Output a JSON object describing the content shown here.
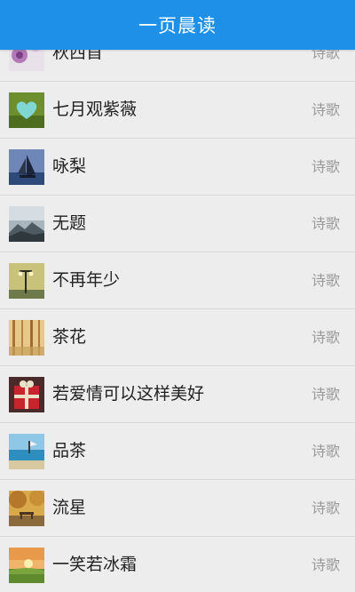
{
  "header": {
    "title": "一页晨读",
    "color": "#1e90e8"
  },
  "list": {
    "items": [
      {
        "title": "秋西首",
        "category": "诗歌",
        "thumb": "purple-flower-icon"
      },
      {
        "title": "七月观紫薇",
        "category": "诗歌",
        "thumb": "heart-lake-icon"
      },
      {
        "title": "咏梨",
        "category": "诗歌",
        "thumb": "sailboat-icon"
      },
      {
        "title": "无题",
        "category": "诗歌",
        "thumb": "misty-mountain-icon"
      },
      {
        "title": "不再年少",
        "category": "诗歌",
        "thumb": "street-lamp-icon"
      },
      {
        "title": "茶花",
        "category": "诗歌",
        "thumb": "sunlit-trees-icon"
      },
      {
        "title": "若爱情可以这样美好",
        "category": "诗歌",
        "thumb": "red-gift-icon"
      },
      {
        "title": "品茶",
        "category": "诗歌",
        "thumb": "seaside-icon"
      },
      {
        "title": "流星",
        "category": "诗歌",
        "thumb": "autumn-bench-icon"
      },
      {
        "title": "一笑若冰霜",
        "category": "诗歌",
        "thumb": "sunset-field-icon"
      }
    ]
  }
}
